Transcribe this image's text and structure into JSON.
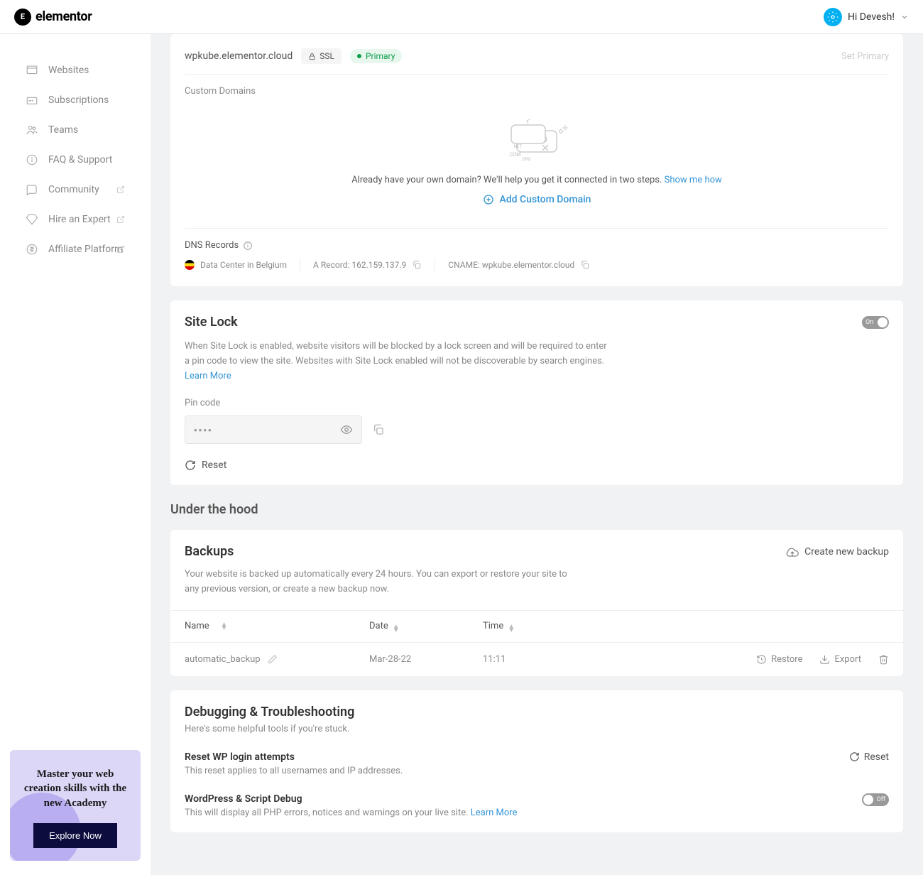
{
  "header": {
    "brand": "elementor",
    "user_greeting": "Hi Devesh!"
  },
  "sidebar": {
    "items": [
      {
        "label": "Websites"
      },
      {
        "label": "Subscriptions"
      },
      {
        "label": "Teams"
      },
      {
        "label": "FAQ & Support"
      },
      {
        "label": "Community",
        "external": true
      },
      {
        "label": "Hire an Expert",
        "external": true
      },
      {
        "label": "Affiliate Platform",
        "external": true
      }
    ],
    "promo": {
      "title": "Master your web creation skills with the new Academy",
      "cta": "Explore Now"
    }
  },
  "domain": {
    "name": "wpkube.elementor.cloud",
    "ssl_label": "SSL",
    "primary_label": "Primary",
    "set_primary": "Set Primary",
    "custom_label": "Custom Domains",
    "help_text": "Already have your own domain? We'll help you get it connected in two steps. ",
    "show_me": "Show me how",
    "add_custom": "Add Custom Domain"
  },
  "dns": {
    "title": "DNS Records",
    "datacenter": "Data Center in Belgium",
    "a_record": "A Record: 162.159.137.9",
    "cname": "CNAME: wpkube.elementor.cloud"
  },
  "sitelock": {
    "title": "Site Lock",
    "toggle": "On",
    "desc": "When Site Lock is enabled, website visitors will be blocked by a lock screen and will be required to enter a pin code to view the site. Websites with Site Lock enabled will not be discoverable by search engines. ",
    "learn_more": "Learn More",
    "pin_label": "Pin code",
    "pin_value": "••••",
    "reset": "Reset"
  },
  "hood": {
    "title": "Under the hood"
  },
  "backups": {
    "title": "Backups",
    "create": "Create new backup",
    "desc": "Your website is backed up automatically every 24 hours. You can export or restore your site to any previous version, or create a new backup now.",
    "cols": {
      "name": "Name",
      "date": "Date",
      "time": "Time"
    },
    "rows": [
      {
        "name": "automatic_backup",
        "date": "Mar-28-22",
        "time": "11:11"
      }
    ],
    "restore": "Restore",
    "export": "Export"
  },
  "debug": {
    "title": "Debugging & Troubleshooting",
    "sub": "Here's some helpful tools if you're stuck.",
    "reset_wp": {
      "title": "Reset WP login attempts",
      "desc": "This reset applies to all usernames and IP addresses.",
      "action": "Reset"
    },
    "script_debug": {
      "title": "WordPress & Script Debug",
      "desc": "This will display all PHP errors, notices and warnings on your live site. ",
      "learn_more": "Learn More",
      "toggle": "Off"
    }
  }
}
